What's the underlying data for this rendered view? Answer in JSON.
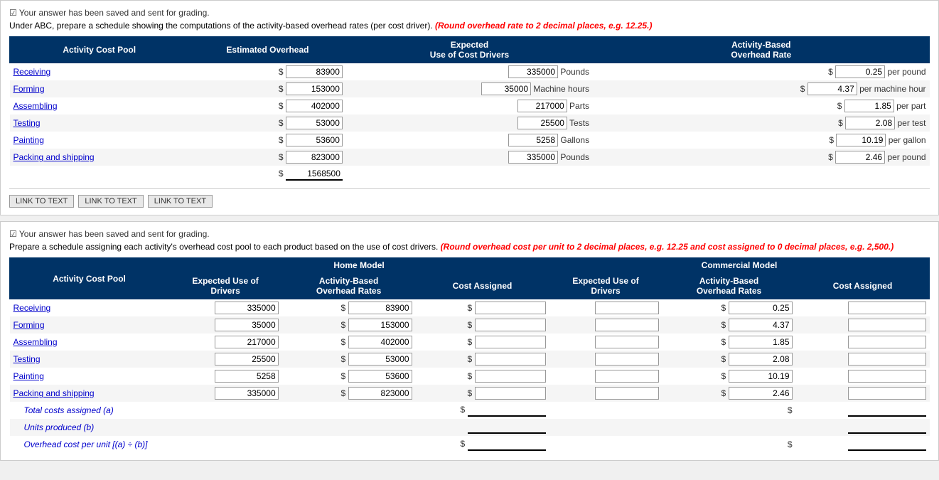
{
  "section1": {
    "saved_msg": "Your answer has been saved and sent for grading.",
    "instruction": "Under ABC, prepare a schedule showing the computations of the activity-based overhead rates (per cost driver).",
    "instruction_red": "(Round overhead rate to 2 decimal places, e.g. 12.25.)",
    "col_activity": "Activity Cost Pool",
    "col_estimated": "Estimated Overhead",
    "col_expected": "Expected Use of Cost Drivers",
    "col_rate": "Activity-Based Overhead Rate",
    "rows": [
      {
        "label": "Receiving",
        "overhead": "83900",
        "expected": "335000",
        "unit": "Pounds",
        "rate": "0.25",
        "rate_unit": "per pound"
      },
      {
        "label": "Forming",
        "overhead": "153000",
        "expected": "35000",
        "unit": "Machine hours",
        "rate": "4.37",
        "rate_unit": "per machine hour"
      },
      {
        "label": "Assembling",
        "overhead": "402000",
        "expected": "217000",
        "unit": "Parts",
        "rate": "1.85",
        "rate_unit": "per part"
      },
      {
        "label": "Testing",
        "overhead": "53000",
        "expected": "25500",
        "unit": "Tests",
        "rate": "2.08",
        "rate_unit": "per test"
      },
      {
        "label": "Painting",
        "overhead": "53600",
        "expected": "5258",
        "unit": "Gallons",
        "rate": "10.19",
        "rate_unit": "per gallon"
      },
      {
        "label": "Packing and shipping",
        "overhead": "823000",
        "expected": "335000",
        "unit": "Pounds",
        "rate": "2.46",
        "rate_unit": "per pound"
      }
    ],
    "total": "1568500",
    "links": [
      "LINK TO TEXT",
      "LINK TO TEXT",
      "LINK TO TEXT"
    ]
  },
  "section2": {
    "saved_msg": "Your answer has been saved and sent for grading.",
    "instruction": "Prepare a schedule assigning each activity's overhead cost pool to each product based on the use of cost drivers.",
    "instruction_red": "(Round overhead cost per unit to 2 decimal places, e.g. 12.25 and cost assigned to 0 decimal places, e.g. 2,500.)",
    "col_activity": "Activity Cost Pool",
    "home_model_label": "Home Model",
    "commercial_model_label": "Commercial Model",
    "col_exp_drivers": "Expected Use of Drivers",
    "col_abc_rates": "Activity-Based Overhead Rates",
    "col_cost_assigned": "Cost Assigned",
    "rows": [
      {
        "label": "Receiving",
        "home_exp": "335000",
        "home_rate": "83900",
        "commercial_rate": "0.25"
      },
      {
        "label": "Forming",
        "home_exp": "35000",
        "home_rate": "153000",
        "commercial_rate": "4.37"
      },
      {
        "label": "Assembling",
        "home_exp": "217000",
        "home_rate": "402000",
        "commercial_rate": "1.85"
      },
      {
        "label": "Testing",
        "home_exp": "25500",
        "home_rate": "53000",
        "commercial_rate": "2.08"
      },
      {
        "label": "Painting",
        "home_exp": "5258",
        "home_rate": "53600",
        "commercial_rate": "10.19"
      },
      {
        "label": "Packing and shipping",
        "home_exp": "335000",
        "home_rate": "823000",
        "commercial_rate": "2.46"
      }
    ],
    "total_costs_label": "Total costs assigned (a)",
    "units_produced_label": "Units produced (b)",
    "overhead_cost_label": "Overhead cost per unit [(a) ÷ (b)]"
  }
}
